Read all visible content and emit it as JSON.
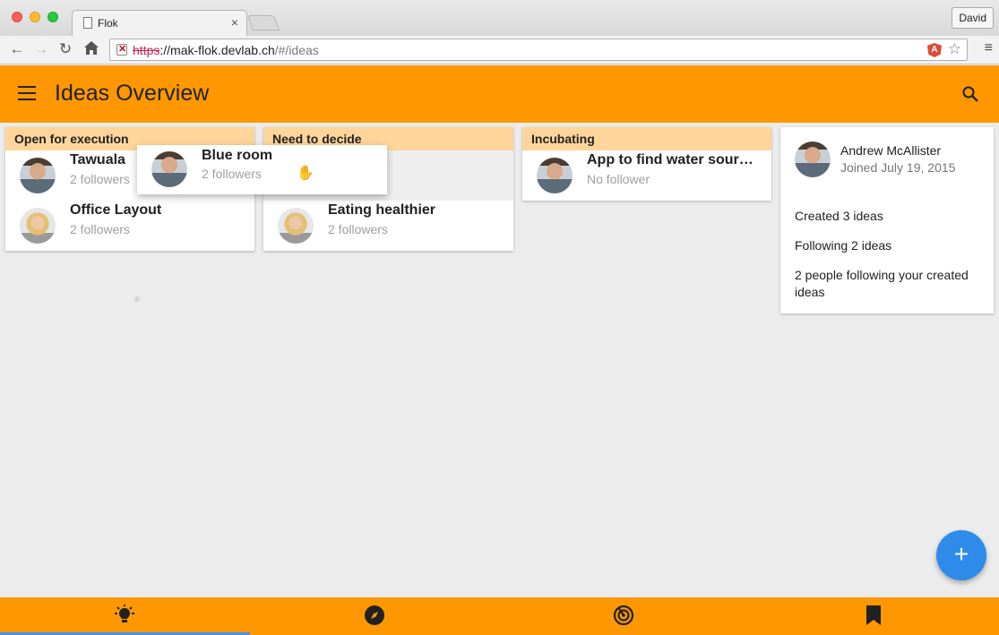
{
  "browser": {
    "tab_title": "Flok",
    "tab_close": "×",
    "profile_name": "David",
    "url_scheme": "https",
    "url_rest": "://mak-flok.devlab.ch",
    "url_path": "/#/ideas",
    "extension_letter": "A"
  },
  "appbar": {
    "title": "Ideas Overview"
  },
  "columns": [
    {
      "title": "Open for execution",
      "ideas": [
        {
          "title": "Tawuala",
          "followers": "2 followers",
          "avatar": "male"
        },
        {
          "title": "Office Layout",
          "followers": "2 followers",
          "avatar": "female"
        }
      ]
    },
    {
      "title": "Need to decide",
      "ideas": [
        {
          "title": "Eating healthier",
          "followers": "2 followers",
          "avatar": "female"
        }
      ]
    },
    {
      "title": "Incubating",
      "ideas": [
        {
          "title": "App to find water sourc…",
          "followers": "No follower",
          "avatar": "male"
        }
      ]
    }
  ],
  "dragging": {
    "title": "Blue room",
    "followers": "2 followers"
  },
  "profile": {
    "name": "Andrew McAllister",
    "joined": "Joined July 19, 2015",
    "created": "Created 3 ideas",
    "following": "Following 2 ideas",
    "followers": "2 people following your created ideas"
  },
  "fab": {
    "label": "+"
  },
  "bottom_nav": {
    "items": [
      "lightbulb-icon",
      "compass-icon",
      "radar-icon",
      "bookmark-icon"
    ],
    "active_index": 0
  },
  "colors": {
    "primary": "#ff9800",
    "column_header": "#ffd59b",
    "fab": "#2e8bea",
    "active_indicator": "#4a90e2"
  }
}
